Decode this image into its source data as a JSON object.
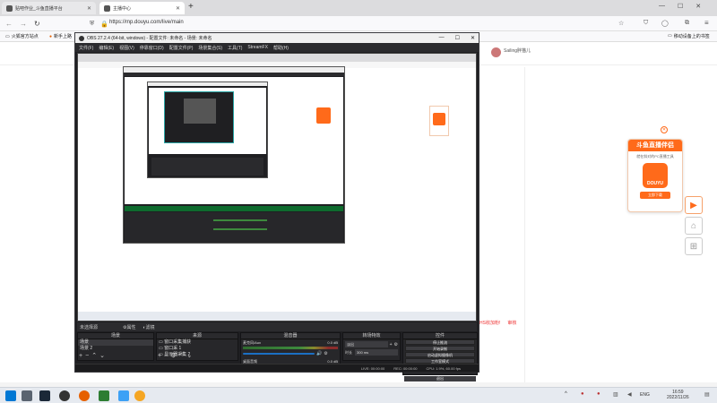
{
  "browser": {
    "tabs": [
      {
        "label": "贴吧作业_斗鱼直播平台",
        "active": false
      },
      {
        "label": "主播中心",
        "active": true
      }
    ],
    "new_tab": "+",
    "url": "https://mp.douyu.com/live/main",
    "bookmarks": [
      "火狐官方站点",
      "新手上路"
    ],
    "mobile_bookmarks": "移动设备上的书签",
    "user_name": "Sailing胖猫儿"
  },
  "obs": {
    "title": "OBS 27.2.4 (64-bit, windows) - 配置文件: 未命名 - 场景: 未命名",
    "menu": [
      "文件(F)",
      "编辑(E)",
      "视图(V)",
      "停靠窗口(D)",
      "配置文件(P)",
      "场景集合(S)",
      "工具(T)",
      "StreamFX",
      "帮助(H)"
    ],
    "source_bar": {
      "label": "未选择源",
      "properties": "属性",
      "filters": "滤镜"
    },
    "docks": {
      "scenes": "场景",
      "sources": "来源",
      "mixer": "混音器",
      "transitions": "转场特效",
      "controls": "控件"
    },
    "scenes": [
      "场景",
      "场景 2"
    ],
    "sources": [
      "窗口采集捕获",
      "窗口采 1",
      "显示器采集 2"
    ],
    "mixer": [
      {
        "name": "麦克风/Aux",
        "db": "0.0 dB"
      },
      {
        "name": "桌面音频",
        "db": "0.0 dB"
      }
    ],
    "transition": {
      "type": "淡出",
      "duration_label": "时长",
      "duration": "300 ms"
    },
    "controls": [
      "停止推流",
      "开始录制",
      "启动虚拟摄像机",
      "工作室模式",
      "设置",
      "退出"
    ],
    "status": {
      "live": "LIVE: 00:00:00",
      "rec": "REC: 00:00:00",
      "cpu": "CPU: 1.9%, 60.00 fps"
    }
  },
  "page": {
    "red_text_1": "HS收加粉!",
    "red_text_2": "审核"
  },
  "promo": {
    "title": "斗鱼直播伴侣",
    "subtitle": "就在斜对的PC直播工具",
    "logo_text": "DOUYU",
    "button": "立即下载"
  },
  "taskbar": {
    "time": "16:59",
    "date": "2022/11/26",
    "lang": "ENG"
  },
  "colors": {
    "accent": "#ff6a1a",
    "obs_bg": "#1f1f22",
    "obs_blue": "#1b6fc4"
  }
}
